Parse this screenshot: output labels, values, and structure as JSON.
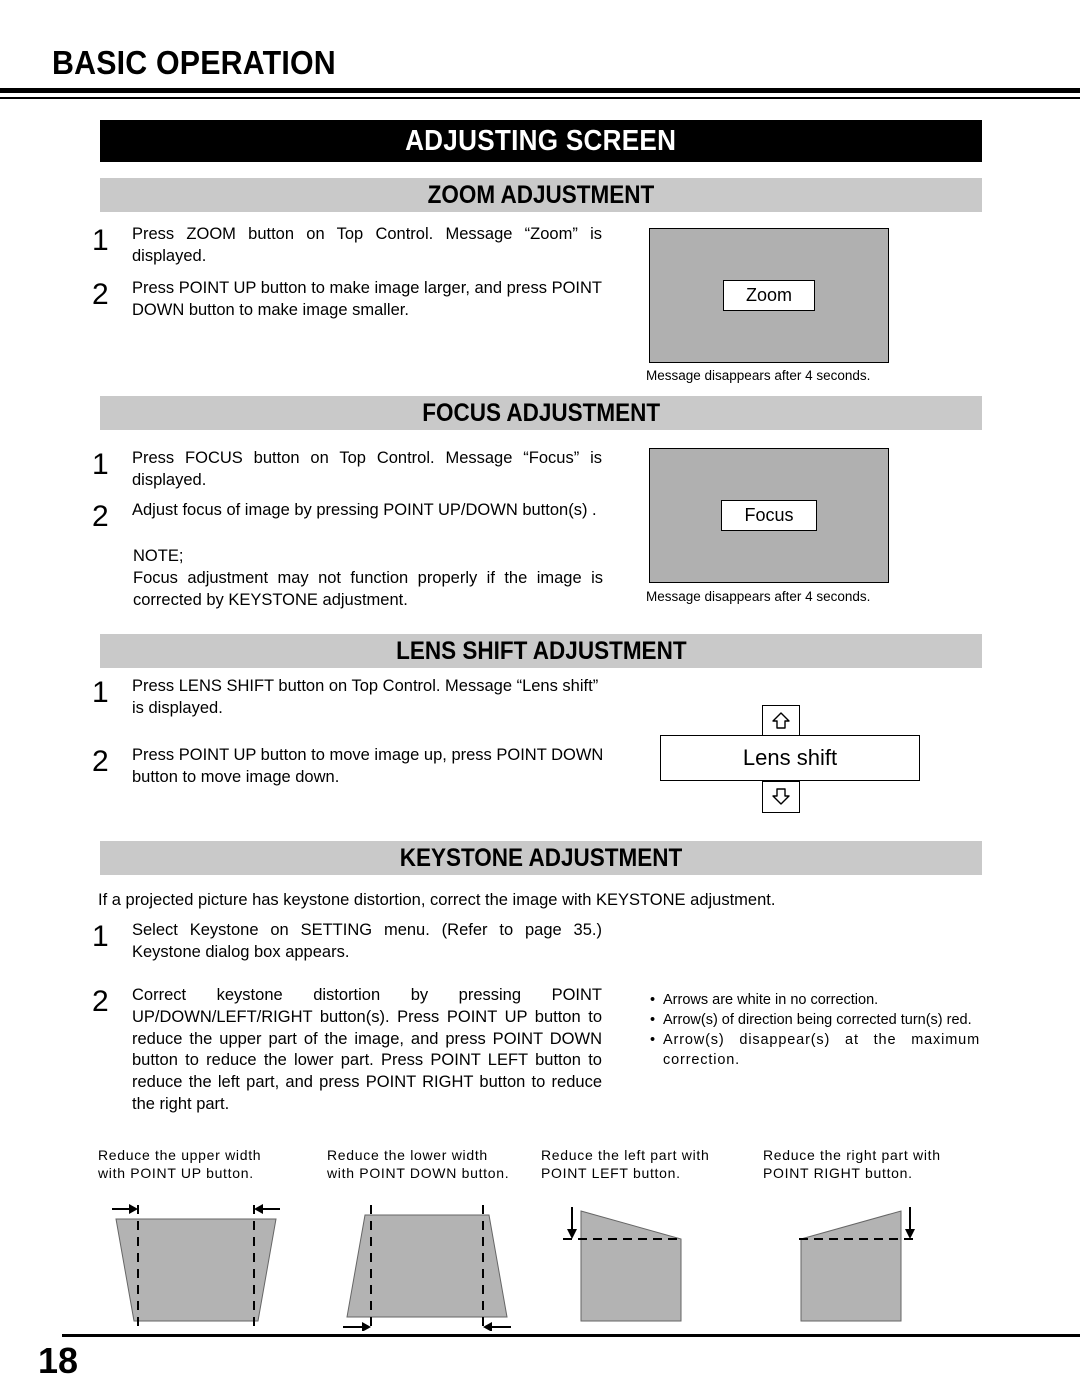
{
  "page": {
    "title": "BASIC OPERATION",
    "number": "18",
    "banner": "ADJUSTING SCREEN"
  },
  "sections": {
    "zoom": {
      "heading": "ZOOM ADJUSTMENT",
      "steps": [
        {
          "num": "1",
          "text": "Press ZOOM button on Top Control. Message “Zoom” is displayed."
        },
        {
          "num": "2",
          "text": "Press POINT UP button to make image larger, and press POINT DOWN button to make image smaller."
        }
      ],
      "osd_label": "Zoom",
      "osd_caption": "Message disappears after 4 seconds."
    },
    "focus": {
      "heading": "FOCUS ADJUSTMENT",
      "steps": [
        {
          "num": "1",
          "text": "Press FOCUS button on Top Control. Message “Focus” is displayed."
        },
        {
          "num": "2",
          "text": "Adjust focus of image by pressing POINT UP/DOWN button(s) ."
        }
      ],
      "note_title": "NOTE;",
      "note_text": "Focus adjustment may not function properly if the image is corrected by KEYSTONE adjustment.",
      "osd_label": "Focus",
      "osd_caption": "Message disappears after 4 seconds."
    },
    "lens_shift": {
      "heading": "LENS SHIFT ADJUSTMENT",
      "steps": [
        {
          "num": "1",
          "text": "Press LENS SHIFT button on Top Control. Message “Lens shift” is displayed."
        },
        {
          "num": "2",
          "text": "Press POINT UP button to move image up, press POINT DOWN button to move image down."
        }
      ],
      "osd_label": "Lens shift",
      "arrow_up": "up-arrow-icon",
      "arrow_down": "down-arrow-icon"
    },
    "keystone": {
      "heading": "KEYSTONE ADJUSTMENT",
      "intro": "If a projected picture has keystone distortion, correct the image with KEYSTONE adjustment.",
      "steps": [
        {
          "num": "1",
          "text": "Select Keystone on SETTING menu. (Refer to page 35.) Keystone dialog box appears."
        },
        {
          "num": "2",
          "text": "Correct keystone distortion by pressing POINT UP/DOWN/LEFT/RIGHT button(s).  Press POINT UP button to reduce the upper part of the image, and press POINT DOWN button to reduce the lower part.  Press POINT LEFT button to reduce the left part, and press POINT RIGHT button to reduce the right part."
        }
      ],
      "bullets": [
        "Arrows are white in no correction.",
        "Arrow(s) of direction being corrected turn(s) red.",
        "Arrow(s) disappear(s) at the maximum correction."
      ],
      "figures": [
        {
          "caption": "Reduce the upper width\nwith POINT UP button.",
          "shape": "trapezoid-narrow-bottom"
        },
        {
          "caption": "Reduce the lower width\nwith POINT DOWN button.",
          "shape": "trapezoid-narrow-top"
        },
        {
          "caption": "Reduce the left part with\nPOINT LEFT button.",
          "shape": "slant-down-left"
        },
        {
          "caption": "Reduce the right part with\nPOINT RIGHT button.",
          "shape": "slant-down-right"
        }
      ]
    }
  },
  "colors": {
    "bar_gray": "#c9c9c9",
    "osd_gray": "#b0b0b0",
    "figure_gray": "#b3b3b3",
    "banner_black": "#000000"
  }
}
